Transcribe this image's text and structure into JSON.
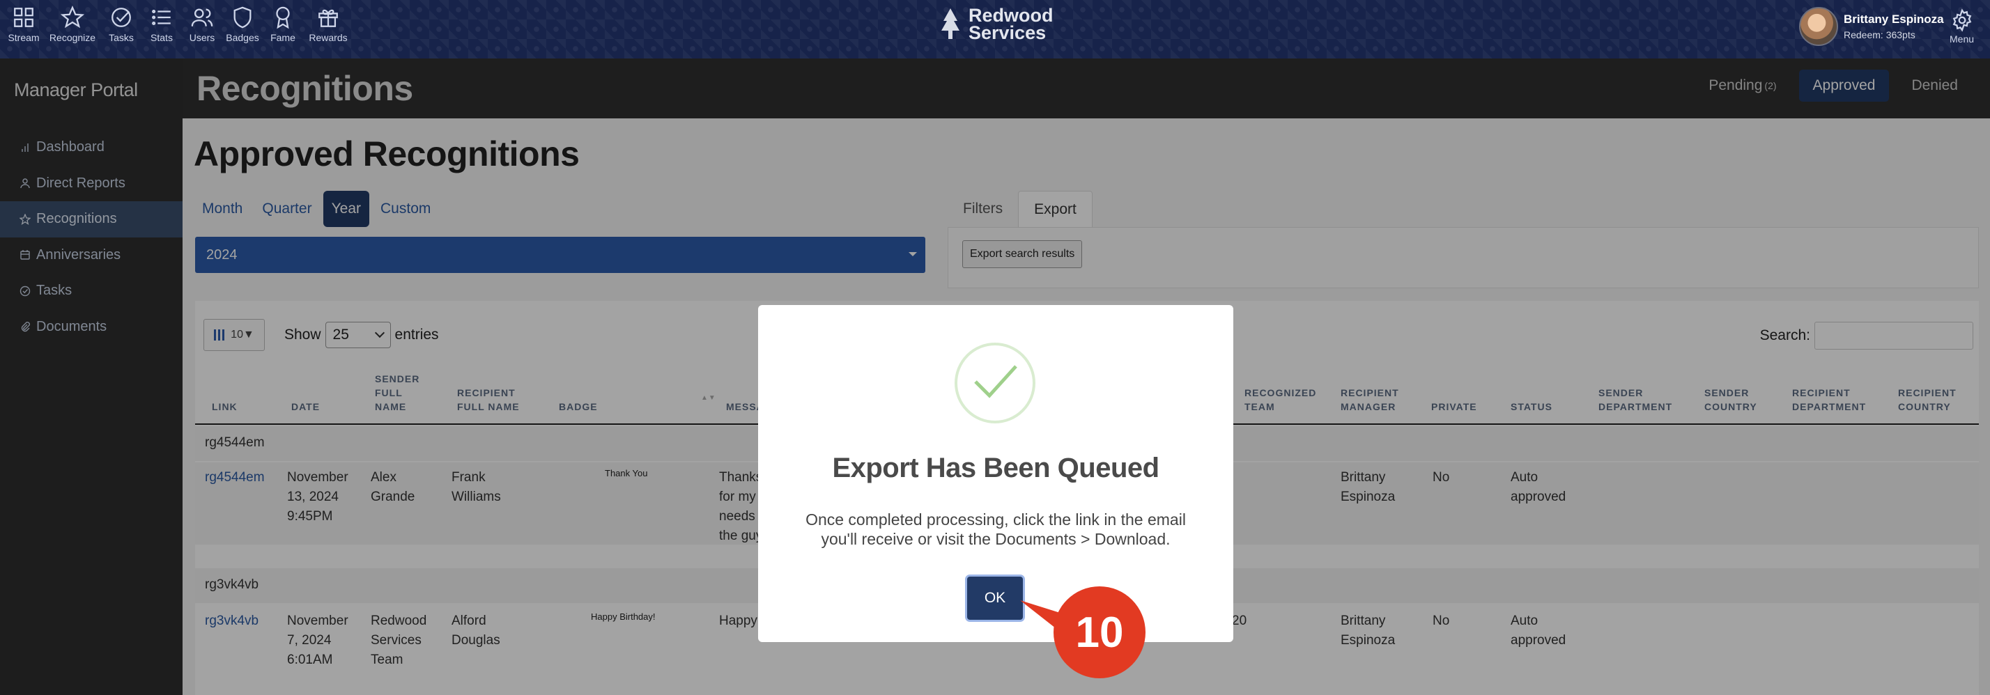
{
  "topnav": {
    "items": [
      {
        "label": "Stream",
        "icon": "grid-icon"
      },
      {
        "label": "Recognize",
        "icon": "star-icon"
      },
      {
        "label": "Tasks",
        "icon": "check-circle-icon"
      },
      {
        "label": "Stats",
        "icon": "list-icon"
      },
      {
        "label": "Users",
        "icon": "users-icon"
      },
      {
        "label": "Badges",
        "icon": "shield-icon"
      },
      {
        "label": "Fame",
        "icon": "ribbon-icon"
      },
      {
        "label": "Rewards",
        "icon": "gift-icon"
      }
    ],
    "brand_line1": "Redwood",
    "brand_line2": "Services",
    "user_name": "Brittany Espinoza",
    "user_points": "Redeem: 363pts",
    "menu_label": "Menu"
  },
  "sidebar": {
    "title": "Manager Portal",
    "items": [
      {
        "label": "Dashboard",
        "icon": "bar-chart-icon"
      },
      {
        "label": "Direct Reports",
        "icon": "person-icon"
      },
      {
        "label": "Recognitions",
        "icon": "star-icon"
      },
      {
        "label": "Anniversaries",
        "icon": "calendar-icon"
      },
      {
        "label": "Tasks",
        "icon": "check-circle-icon"
      },
      {
        "label": "Documents",
        "icon": "paperclip-icon"
      }
    ]
  },
  "header": {
    "title": "Recognitions",
    "tabs": {
      "pending": "Pending",
      "pending_count": "(2)",
      "approved": "Approved",
      "denied": "Denied"
    }
  },
  "main": {
    "title": "Approved Recognitions",
    "period_tabs": [
      "Month",
      "Quarter",
      "Year",
      "Custom"
    ],
    "year_value": "2024",
    "filter_tabs": [
      "Filters",
      "Export"
    ],
    "export_button": "Export search results",
    "col_toggle_count": "10▼",
    "show_label": "Show",
    "entries_value": "25",
    "entries_label": "entries",
    "search_label": "Search:"
  },
  "table": {
    "headers": {
      "link": "LINK",
      "date": "DATE",
      "sender": [
        "SENDER",
        "FULL",
        "NAME"
      ],
      "recipient": [
        "RECIPIENT",
        "FULL NAME"
      ],
      "badge": "BADGE",
      "message": "MESSA",
      "recognized_team": [
        "RECOGNIZED",
        "TEAM"
      ],
      "recipient_manager": [
        "RECIPIENT",
        "MANAGER"
      ],
      "private": "PRIVATE",
      "status": "STATUS",
      "sender_department": [
        "SENDER",
        "DEPARTMENT"
      ],
      "sender_country": [
        "SENDER",
        "COUNTRY"
      ],
      "recipient_department": [
        "RECIPIENT",
        "DEPARTMENT"
      ],
      "recipient_country": [
        "RECIPIENT",
        "COUNTRY"
      ]
    },
    "groups": [
      {
        "group_label": "rg4544em",
        "link": "rg4544em",
        "date": [
          "November",
          "13, 2024",
          "9:45PM"
        ],
        "sender": [
          "Alex",
          "Grande"
        ],
        "recipient": [
          "Frank",
          "Williams"
        ],
        "badge": "Thank You",
        "message": [
          "Thanks",
          "for my",
          "needs",
          "the guy"
        ],
        "manager": [
          "Brittany",
          "Espinoza"
        ],
        "private": "No",
        "status": [
          "Auto",
          "approved"
        ]
      },
      {
        "group_label": "rg3vk4vb",
        "link": "rg3vk4vb",
        "date": [
          "November",
          "7, 2024",
          "6:01AM"
        ],
        "sender": [
          "Redwood",
          "Services",
          "Team"
        ],
        "recipient": [
          "Alford",
          "Douglas"
        ],
        "badge": "Happy Birthday!",
        "message": [
          "Happy Birthday from Redwood!"
        ],
        "points": "20",
        "manager": [
          "Brittany",
          "Espinoza"
        ],
        "private": "No",
        "status": [
          "Auto",
          "approved"
        ]
      }
    ]
  },
  "modal": {
    "title": "Export Has Been Queued",
    "text": "Once completed processing, click the link in the email you'll receive or visit the Documents > Download.",
    "ok_label": "OK"
  },
  "annotation": {
    "step_number": "10",
    "color": "#e23a22"
  }
}
